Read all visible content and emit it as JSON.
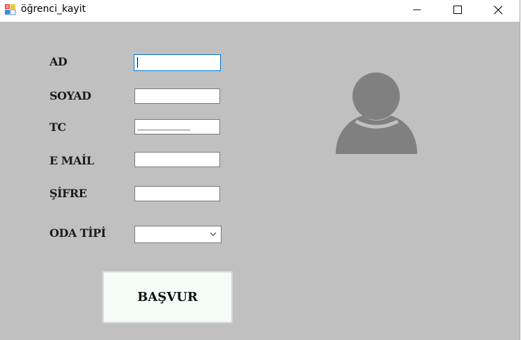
{
  "window": {
    "title": "öğrenci_kayit",
    "icon": "winforms-app-icon",
    "buttons": {
      "minimize_icon": "minimize-icon",
      "maximize_icon": "maximize-icon",
      "close_icon": "close-icon"
    }
  },
  "form": {
    "fields": [
      {
        "key": "ad",
        "label": "AD",
        "value": ""
      },
      {
        "key": "soyad",
        "label": "SOYAD",
        "value": ""
      },
      {
        "key": "tc",
        "label": "TC",
        "value": "___________"
      },
      {
        "key": "email",
        "label": "E MAİL",
        "value": ""
      },
      {
        "key": "sifre",
        "label": "ŞİFRE",
        "value": ""
      }
    ],
    "room_type": {
      "label": "ODA TİPİ",
      "selected": ""
    },
    "submit_label": "BAŞVUR"
  },
  "avatar_icon": "user-avatar-icon",
  "colors": {
    "background": "#c0c0c0",
    "button_bg": "#f3fcf7",
    "focus_border": "#0078d7",
    "avatar": "#808080"
  }
}
